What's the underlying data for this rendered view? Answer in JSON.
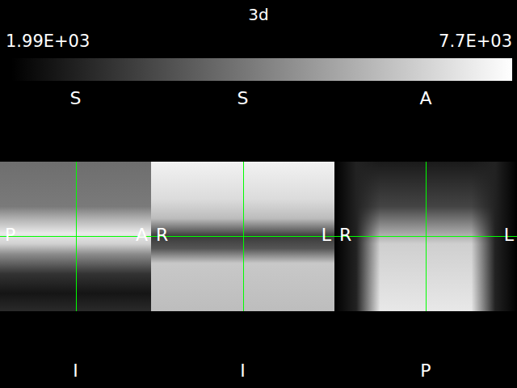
{
  "title": "3d",
  "colorbar": {
    "min": "1.99E+03",
    "max": "7.7E+03"
  },
  "panels": [
    {
      "view": "sagittal",
      "top": "S",
      "bottom": "I",
      "left": "P",
      "right": "A"
    },
    {
      "view": "coronal",
      "top": "S",
      "bottom": "I",
      "left": "R",
      "right": "L"
    },
    {
      "view": "axial",
      "top": "A",
      "bottom": "P",
      "left": "R",
      "right": "L"
    }
  ]
}
